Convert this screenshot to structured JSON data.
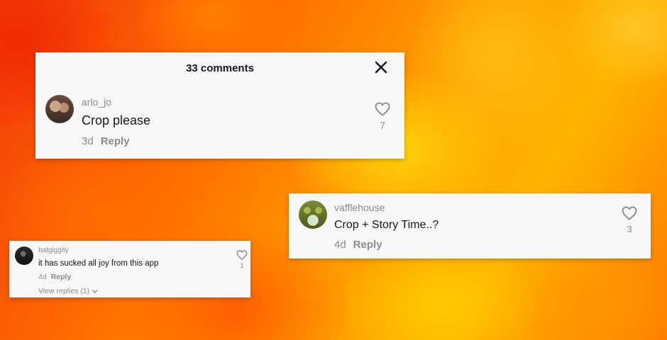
{
  "colors": {
    "card_background": "#f7f7f8",
    "primary_text": "#161823",
    "secondary_text": "#8a8b91"
  },
  "icons": {
    "close": "close-icon",
    "like": "heart-outline-icon",
    "expand": "chevron-down-icon"
  },
  "card1": {
    "header_title": "33 comments",
    "comment": {
      "username": "arlo_jo",
      "text": "Crop please",
      "age": "3d",
      "reply_label": "Reply",
      "likes": "7"
    }
  },
  "card2": {
    "comment": {
      "username": "vafflehouse",
      "text": "Crop + Story Time..?",
      "age": "4d",
      "reply_label": "Reply",
      "likes": "3"
    }
  },
  "card3": {
    "comment": {
      "username": "batgiggity",
      "text": "it has sucked all joy from this app",
      "age": "4d",
      "reply_label": "Reply",
      "likes": "1",
      "view_replies_label": "View replies (1)"
    }
  }
}
